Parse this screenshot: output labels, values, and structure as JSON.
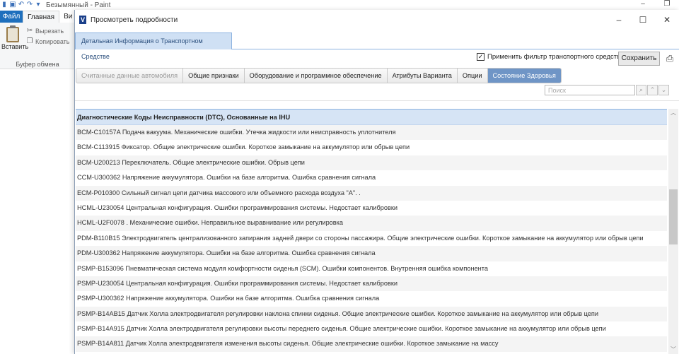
{
  "paint": {
    "window_title": "Безымянный - Paint",
    "tabs": [
      "Файл",
      "Главная",
      "Ви"
    ],
    "paste_label": "Вставить",
    "cut_label": "Вырезать",
    "copy_label": "Копировать",
    "clipboard_group": "Буфер обмена"
  },
  "dialog": {
    "title": "Просмотреть подробности",
    "main_tab": "Детальная Информация о Транспортном Средстве",
    "filter_label": "Применить фильтр транспортного средства",
    "filter_checked": true,
    "save_label": "Сохранить",
    "section_tabs": [
      {
        "label": "Считанные данные автомобиля",
        "state": "disabled"
      },
      {
        "label": "Общие признаки",
        "state": "normal"
      },
      {
        "label": "Оборудование и программное обеспечение",
        "state": "normal"
      },
      {
        "label": "Атрибуты Варианта",
        "state": "normal"
      },
      {
        "label": "Опции",
        "state": "normal"
      },
      {
        "label": "Состояние Здоровья",
        "state": "active"
      }
    ],
    "search_placeholder": "Поиск",
    "table_header": "Диагностические Коды Неисправности (DTC), Основанные на IHU",
    "rows": [
      "BCM-C10157A Подача вакуума. Механические ошибки. Утечка жидкости или неисправность уплотнителя",
      "BCM-C113915 Фиксатор. Общие электрические ошибки. Короткое замыкание на аккумулятор или обрыв цепи",
      "BCM-U200213 Переключатель. Общие электрические ошибки. Обрыв цепи",
      "CCM-U300362 Напряжение аккумулятора. Ошибки на базе алгоритма. Ошибка сравнения сигнала",
      "ECM-P010300 Сильный сигнал цепи датчика массового или объемного расхода воздуха \"А\". .",
      "HCML-U230054 Центральная конфигурация. Ошибки программирования системы. Недостает калибровки",
      "HCML-U2F0078 . Механические ошибки. Неправильное выравнивание или регулировка",
      "PDM-B110B15 Электродвигатель централизованного запирания задней двери со стороны пассажира. Общие электрические ошибки. Короткое замыкание на аккумулятор или обрыв цепи",
      "PDM-U300362 Напряжение аккумулятора. Ошибки на базе алгоритма. Ошибка сравнения сигнала",
      "PSMP-B153096 Пневматическая система модуля комфортности сиденья (SCM). Ошибки компонентов. Внутренняя ошибка компонента",
      "PSMP-U230054 Центральная конфигурация. Ошибки программирования системы. Недостает калибровки",
      "PSMP-U300362 Напряжение аккумулятора. Ошибки на базе алгоритма. Ошибка сравнения сигнала",
      "PSMP-B14AB15 Датчик Холла электродвигателя регулировки наклона спинки сиденья. Общие электрические ошибки. Короткое замыкание на аккумулятор или обрыв цепи",
      "PSMP-B14A915 Датчик Холла электродвигателя регулировки высоты переднего сиденья. Общие электрические ошибки. Короткое замыкание на аккумулятор или обрыв цепи",
      "PSMP-B14A811 Датчик Холла электродвигателя изменения высоты сиденья. Общие электрические ошибки. Короткое замыкание на массу"
    ]
  },
  "colors": {
    "accent": "#6f95c6",
    "header_bg": "#d6e4f5",
    "file_tab": "#1e6fbd"
  }
}
